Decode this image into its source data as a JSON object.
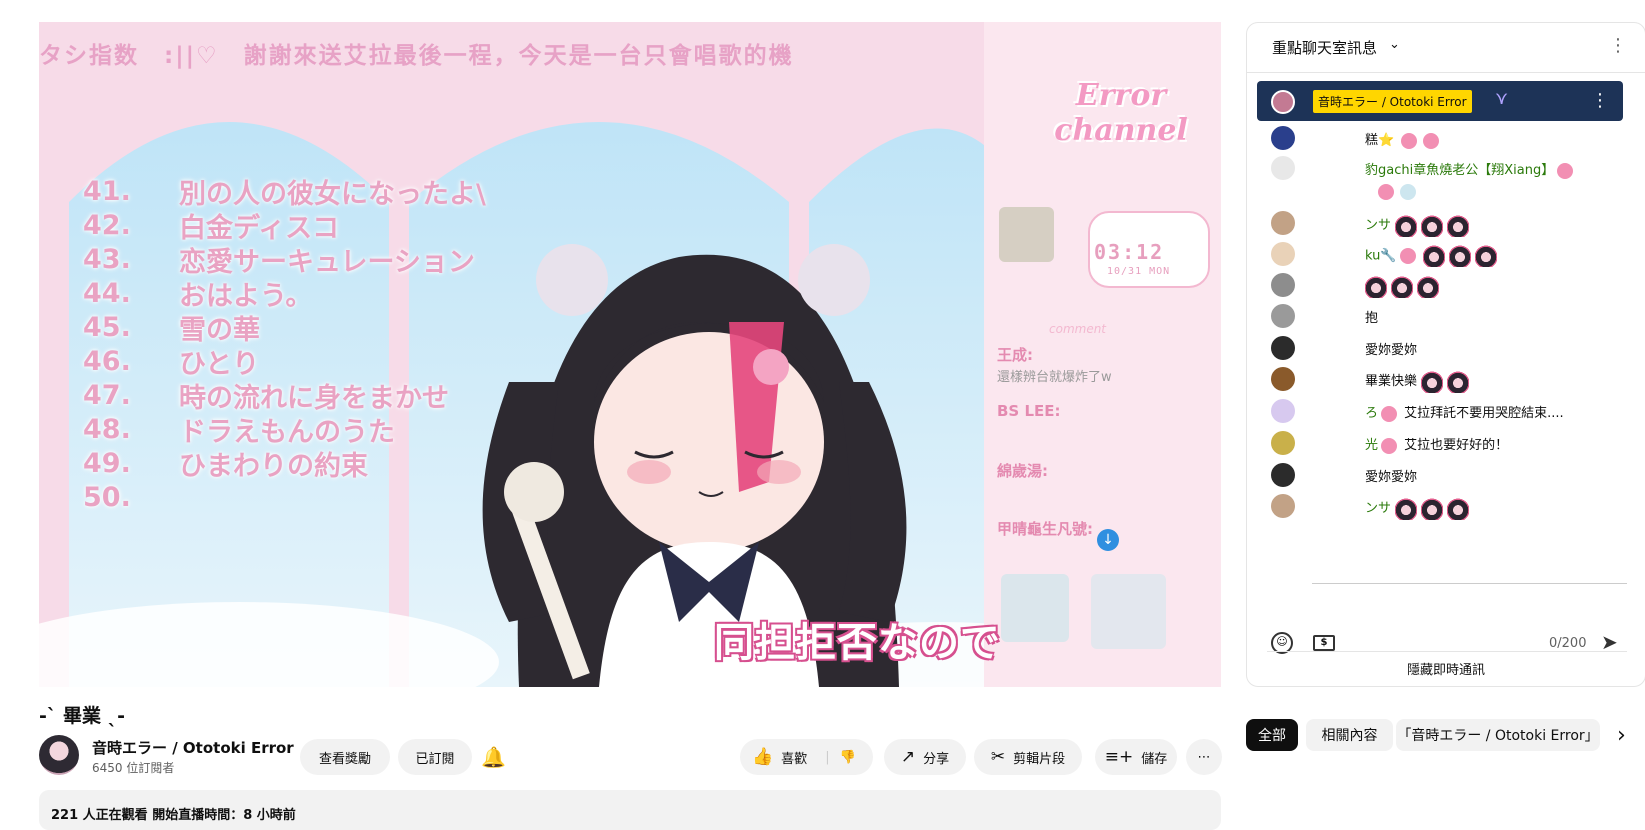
{
  "video": {
    "marquee": "タシ指数　:||♡　謝謝來送艾拉最後一程，今天是一台只會唱歌的機",
    "setlist": [
      {
        "num": "41.",
        "song": "別の人の彼女になったよ\\"
      },
      {
        "num": "42.",
        "song": "白金ディスコ"
      },
      {
        "num": "43.",
        "song": "恋愛サーキュレーション"
      },
      {
        "num": "44.",
        "song": "おはよう。"
      },
      {
        "num": "45.",
        "song": "雪の華"
      },
      {
        "num": "46.",
        "song": "ひとり"
      },
      {
        "num": "47.",
        "song": "時の流れに身をまかせ"
      },
      {
        "num": "48.",
        "song": "ドラえもんのうた"
      },
      {
        "num": "49.",
        "song": "ひまわりの約束"
      },
      {
        "num": "50.",
        "song": ""
      }
    ],
    "logo": "Error channel",
    "clock": "03:12",
    "clock_date": "10/31 MON",
    "comment_heading": "comment",
    "side_chat": [
      {
        "name": "王成:",
        "msg": "還樣辨台就爆炸了w"
      },
      {
        "name": "BS LEE:",
        "msg": ""
      },
      {
        "name": "綿歲湯:",
        "msg": ""
      },
      {
        "name": "甲晴龜生凡號:",
        "msg": ""
      }
    ],
    "subtitle": "同担拒否なので"
  },
  "info": {
    "title": "-ˋ 畢業 ˎ-",
    "channel_name": "音時エラー / Ototoki Error",
    "subscribers": "6450 位訂閱者",
    "view_perks": "查看獎勵",
    "subscribed": "已訂閱",
    "like": "喜歡",
    "share": "分享",
    "clip": "剪輯片段",
    "save": "儲存",
    "watching": "221 人正在觀看  開始直播時間：8 小時前"
  },
  "chat": {
    "header": "重點聊天室訊息",
    "pinned_name": "音時エラー / Ototoki Error",
    "messages": [
      {
        "name": "",
        "text": "糕⭐ ",
        "color": "#2a3f8c"
      },
      {
        "name": "豹gachi章魚燒老公【翔Xiang】",
        "text": "",
        "color": "#e8e8e8"
      },
      {
        "name": "",
        "text": "",
        "color": "#ffffff"
      },
      {
        "name": "ンサ",
        "text": "",
        "color": "#c2a286"
      },
      {
        "name": "ku🔧",
        "text": "",
        "color": "#e9d2b8"
      },
      {
        "name": "",
        "text": "",
        "color": "#8d8d8d"
      },
      {
        "name": "",
        "text": "抱",
        "color": "#9a9a9a"
      },
      {
        "name": "",
        "text": "愛妳愛妳",
        "color": "#2b2b2b"
      },
      {
        "name": "",
        "text": "畢業快樂",
        "color": "#8a5a2b"
      },
      {
        "name": "ろ",
        "text": "艾拉拜託不要用哭腔結束....",
        "color": "#d7c9ef"
      },
      {
        "name": "光",
        "text": "艾拉也要好好的！",
        "color": "#c9b04a"
      },
      {
        "name": "",
        "text": "愛妳愛妳",
        "color": "#2b2b2b"
      },
      {
        "name": "ンサ",
        "text": "",
        "color": "#c2a286"
      }
    ],
    "counter": "0/200",
    "hide": "隱藏即時通訊"
  },
  "chips": {
    "all": "全部",
    "related": "相關內容",
    "channel": "「音時エラー / Ototoki Error」"
  }
}
